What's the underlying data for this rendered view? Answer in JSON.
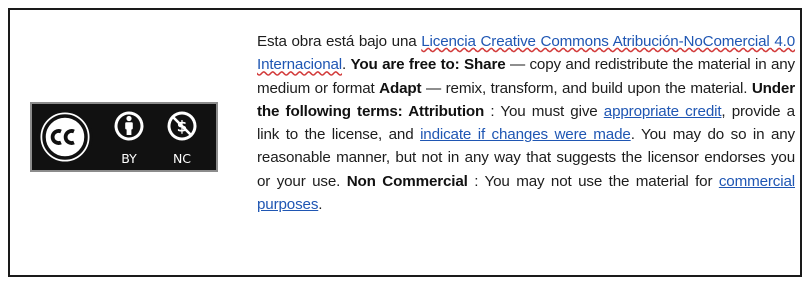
{
  "license_badge": {
    "icons": [
      "cc-logo-icon",
      "person-attribution-icon",
      "no-dollar-noncommercial-icon"
    ],
    "labels": {
      "by": "BY",
      "nc": "NC"
    },
    "colors": {
      "background": "#111111",
      "foreground": "#ffffff",
      "border": "#8c8c8c"
    }
  },
  "notice": {
    "intro": "Esta obra está bajo una ",
    "license_link": "Licencia Creative Commons Atribución-NoComercial 4.0 Internacional",
    "after_link": ". ",
    "free_heading": "You are free to: Share",
    "share_desc": " — copy and redistribute the material in any medium or format ",
    "adapt_heading": "Adapt",
    "adapt_desc": " — remix, transform, and build upon the material. ",
    "terms_heading": "Under the following terms: Attribution",
    "attribution_desc": " : You must give ",
    "credit_link": "appropriate credit",
    "provide_link_text": ", provide a link to the license, and ",
    "changes_link": "indicate if changes were made",
    "reasonable_text": ". You may do so in any reasonable manner, but not in any way that suggests the licensor endorses you or your use. ",
    "noncommercial_heading": "Non Commercial",
    "noncommercial_desc": " : You may not use the material for ",
    "commercial_link": "commercial purposes",
    "end": "."
  },
  "colors": {
    "link": "#1f56b3",
    "text": "#1d1d1d",
    "border": "#1a1a1a"
  }
}
